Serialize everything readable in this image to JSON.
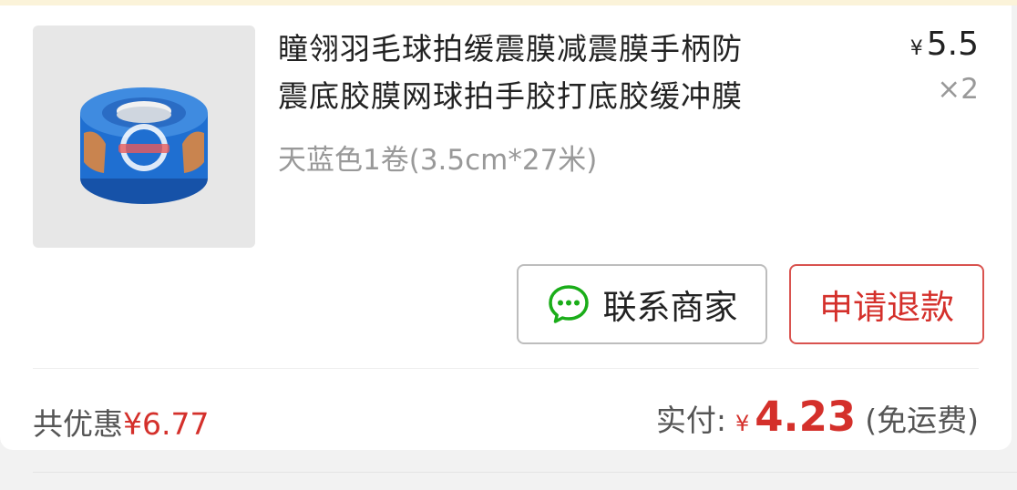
{
  "order_item": {
    "title_line1": "瞳翎羽毛球拍缓震膜减震膜手柄防",
    "title_line2": "震底胶膜网球拍手胶打底胶缓冲膜",
    "spec": "天蓝色1卷(3.5cm*27米)",
    "currency": "¥",
    "price": "5.5",
    "quantity": "×2",
    "image_icon": "blue-tape-roll-image"
  },
  "actions": {
    "contact_label": "联系商家",
    "refund_label": "申请退款",
    "contact_icon": "chat-bubble-icon"
  },
  "summary": {
    "discount_label": "共优惠",
    "discount_amount": "¥6.77",
    "paid_label": "实付:",
    "currency": "¥",
    "paid_amount": "4.23",
    "shipping_note": "(免运费)"
  },
  "colors": {
    "accent_red": "#d4302b",
    "wechat_green": "#1aad19",
    "tape_blue": "#1f6fd1"
  }
}
